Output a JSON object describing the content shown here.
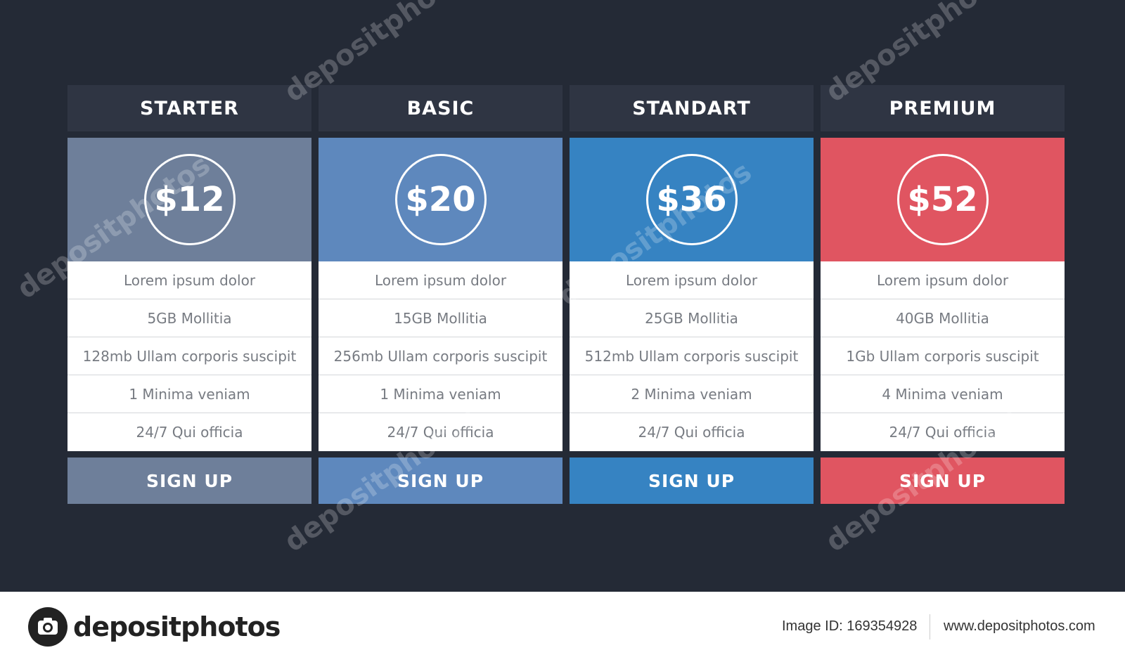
{
  "plans": [
    {
      "name": "STARTER",
      "price": "$12",
      "color": "#6e7f9a",
      "features": [
        "Lorem ipsum dolor",
        "5GB Mollitia",
        "128mb Ullam corporis suscipit",
        "1 Minima veniam",
        "24/7 Qui officia"
      ],
      "cta": "SIGN UP"
    },
    {
      "name": "BASIC",
      "price": "$20",
      "color": "#5e88bd",
      "features": [
        "Lorem ipsum dolor",
        "15GB Mollitia",
        "256mb Ullam corporis suscipit",
        "1 Minima veniam",
        "24/7 Qui officia"
      ],
      "cta": "SIGN UP"
    },
    {
      "name": "STANDART",
      "price": "$36",
      "color": "#3683c2",
      "features": [
        "Lorem ipsum dolor",
        "25GB Mollitia",
        "512mb Ullam corporis suscipit",
        "2 Minima veniam",
        "24/7 Qui officia"
      ],
      "cta": "SIGN UP"
    },
    {
      "name": "PREMIUM",
      "price": "$52",
      "color": "#e05561",
      "features": [
        "Lorem ipsum dolor",
        "40GB Mollitia",
        "1Gb Ullam corporis suscipit",
        "4 Minima veniam",
        "24/7 Qui officia"
      ],
      "cta": "SIGN UP"
    }
  ],
  "watermark": "depositphotos",
  "footer": {
    "logo_text": "depositphotos",
    "image_id": "Image ID: 169354928",
    "site": "www.depositphotos.com"
  }
}
